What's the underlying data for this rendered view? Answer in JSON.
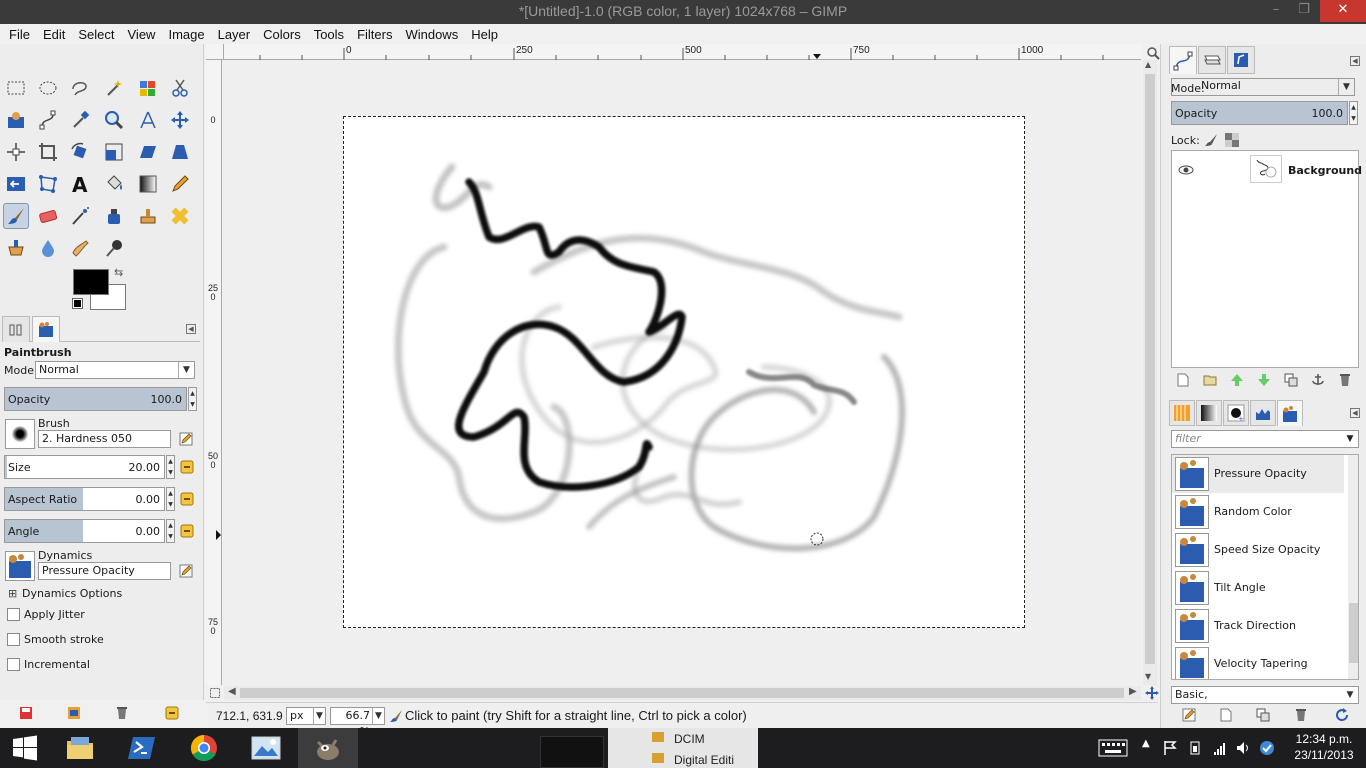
{
  "window": {
    "title": "*[Untitled]-1.0 (RGB color, 1 layer) 1024x768 – GIMP",
    "minimize_glyph": "–",
    "restore_glyph": "❐",
    "close_glyph": "✕"
  },
  "menu": [
    "File",
    "Edit",
    "Select",
    "View",
    "Image",
    "Layer",
    "Colors",
    "Tools",
    "Filters",
    "Windows",
    "Help"
  ],
  "tool_options": {
    "tool_name": "Paintbrush",
    "mode_label": "Mode:",
    "mode_value": "Normal",
    "opacity_label": "Opacity",
    "opacity_value": "100.0",
    "opacity_fraction": 1.0,
    "brush_label": "Brush",
    "brush_value": "2. Hardness 050",
    "size_label": "Size",
    "size_value": "20.00",
    "aspect_label": "Aspect Ratio",
    "aspect_value": "0.00",
    "angle_label": "Angle",
    "angle_value": "0.00",
    "dynamics_label": "Dynamics",
    "dynamics_value": "Pressure Opacity",
    "dynamics_options_label": "Dynamics Options",
    "apply_jitter_label": "Apply Jitter",
    "smooth_stroke_label": "Smooth stroke",
    "incremental_label": "Incremental",
    "expander_glyph": "⊞"
  },
  "rulers": {
    "h_labels": [
      "0",
      "250",
      "500",
      "750",
      "1000"
    ],
    "v_labels": [
      "0",
      "250",
      "500",
      "750"
    ]
  },
  "status": {
    "coords": "712.1, 631.9",
    "unit": "px",
    "zoom": "66.7 %",
    "message": "Click to paint (try Shift for a straight line, Ctrl to pick a color)"
  },
  "layers": {
    "mode_label": "Mode:",
    "mode_value": "Normal",
    "opacity_label": "Opacity",
    "opacity_value": "100.0",
    "lock_label": "Lock:",
    "layer_name": "Background"
  },
  "dynamics_panel": {
    "filter_placeholder": "filter",
    "items": [
      "Pressure Opacity",
      "Random Color",
      "Speed Size Opacity",
      "Tilt Angle",
      "Track Direction",
      "Velocity Tapering"
    ],
    "selected": "Pressure Opacity",
    "tag_value": "Basic,"
  },
  "taskbar": {
    "time": "12:34 p.m.",
    "date": "23/11/2013",
    "desktop_items": [
      "DCIM",
      "Digital Editi"
    ]
  },
  "colors": {
    "foreground": "#000000",
    "background": "#ffffff",
    "accent": "#b8c4d2"
  }
}
